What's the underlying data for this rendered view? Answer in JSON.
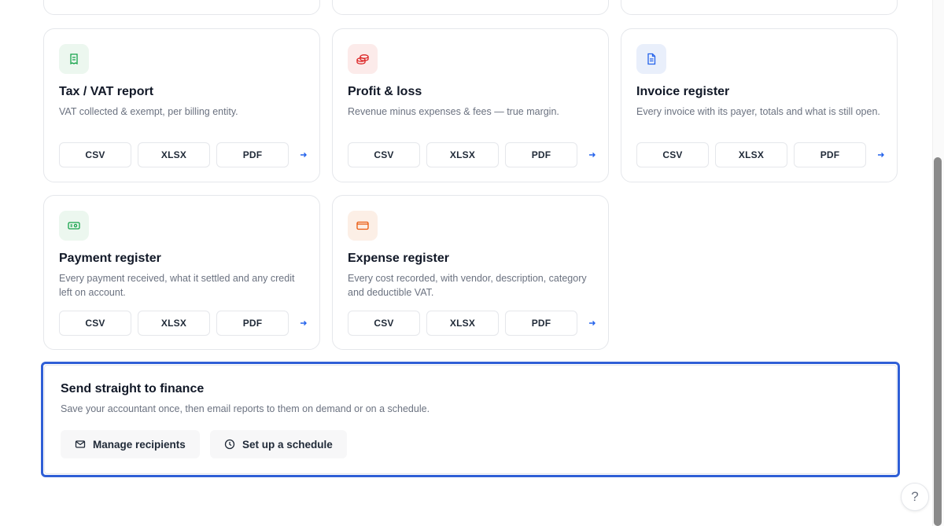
{
  "cards": [
    {
      "title": "Tax / VAT report",
      "desc": "VAT collected & exempt, per billing entity.",
      "icon": "receipt-icon",
      "accent": "#16a34a",
      "icon_bg": "#ecf7ef",
      "formats": [
        "CSV",
        "XLSX",
        "PDF"
      ]
    },
    {
      "title": "Profit & loss",
      "desc": "Revenue minus expenses & fees — true margin.",
      "icon": "coins-icon",
      "accent": "#dc2626",
      "icon_bg": "#fcebea",
      "formats": [
        "CSV",
        "XLSX",
        "PDF"
      ]
    },
    {
      "title": "Invoice register",
      "desc": "Every invoice with its payer, totals and what is still open.",
      "icon": "file-text-icon",
      "accent": "#2563eb",
      "icon_bg": "#e9effb",
      "formats": [
        "CSV",
        "XLSX",
        "PDF"
      ]
    },
    {
      "title": "Payment register",
      "desc": "Every payment received, what it settled and any credit left on account.",
      "icon": "banknote-icon",
      "accent": "#16a34a",
      "icon_bg": "#ecf7ef",
      "formats": [
        "CSV",
        "XLSX",
        "PDF"
      ]
    },
    {
      "title": "Expense register",
      "desc": "Every cost recorded, with vendor, description, category and deductible VAT.",
      "icon": "wallet-icon",
      "accent": "#ea580c",
      "icon_bg": "#fcefe6",
      "formats": [
        "CSV",
        "XLSX",
        "PDF"
      ]
    }
  ],
  "finance": {
    "title": "Send straight to finance",
    "desc": "Save your accountant once, then email reports to them on demand or on a schedule.",
    "manage_label": "Manage recipients",
    "schedule_label": "Set up a schedule"
  },
  "help_label": "?",
  "colors": {
    "focus_border": "#2f5fd6",
    "arrow": "#2563eb"
  }
}
